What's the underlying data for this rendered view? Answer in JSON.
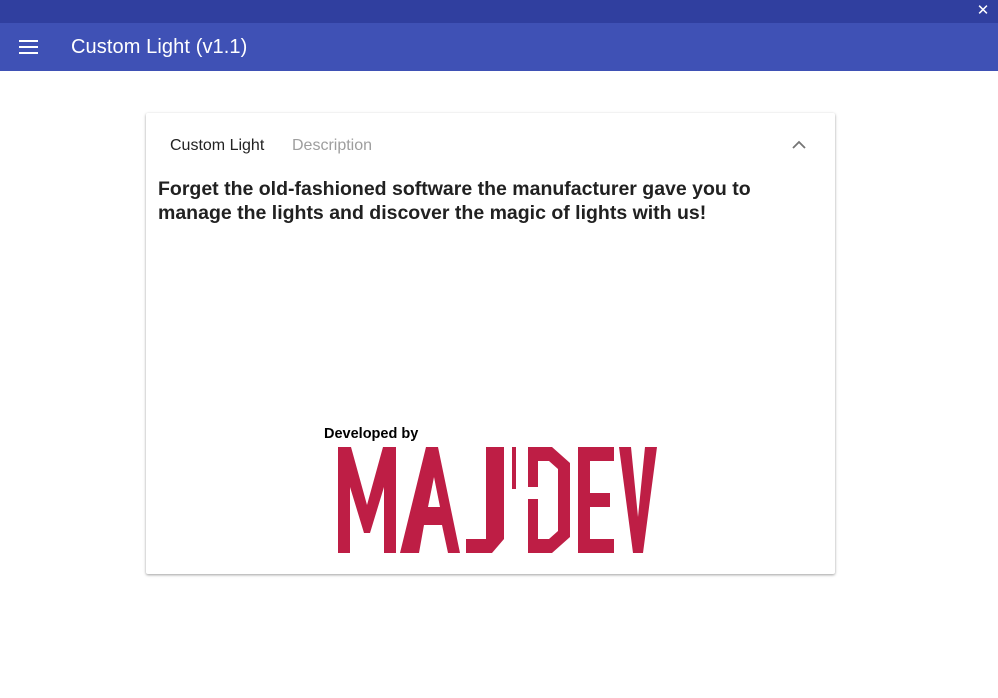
{
  "window": {
    "close_glyph": "✕"
  },
  "appbar": {
    "menu_icon": "hamburger-menu-icon",
    "title": "Custom Light (v1.1)",
    "color": "#3f51b5",
    "titlebar_color": "#303f9f"
  },
  "card": {
    "tabs": [
      {
        "label": "Custom Light",
        "state": "active"
      },
      {
        "label": "Description",
        "state": "inactive"
      }
    ],
    "collapse_icon": "chevron-up-icon",
    "description": "Forget the old-fashioned software the manufacturer gave you to manage the lights and discover the magic of lights with us!",
    "developed_by_label": "Developed by",
    "logo_text": "MAJDEV",
    "logo_color": "#be1e45"
  }
}
